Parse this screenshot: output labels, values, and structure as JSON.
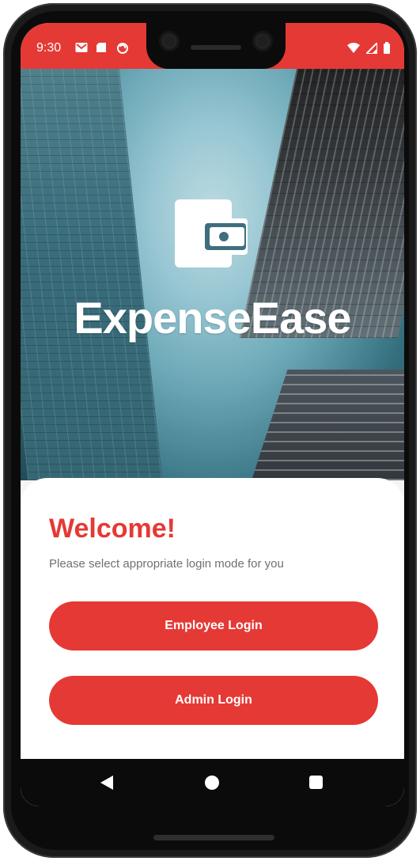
{
  "status_bar": {
    "time": "9:30",
    "background_color": "#e53935",
    "left_icons": [
      "gmail-icon",
      "sd-card-icon",
      "sync-icon"
    ],
    "right_icons": [
      "wifi-icon",
      "signal-icon",
      "battery-icon"
    ]
  },
  "brand": {
    "app_name": "ExpenseEase",
    "logo_icon": "wallet-icon"
  },
  "welcome": {
    "title": "Welcome!",
    "subtitle": "Please select appropriate login mode for you"
  },
  "actions": {
    "employee_login": "Employee Login",
    "admin_login": "Admin Login"
  },
  "theme": {
    "accent": "#e53935",
    "card_background": "#ffffff",
    "subtitle_color": "#707070"
  },
  "nav_bar": {
    "icons": [
      "back-icon",
      "home-icon",
      "recents-icon"
    ]
  }
}
